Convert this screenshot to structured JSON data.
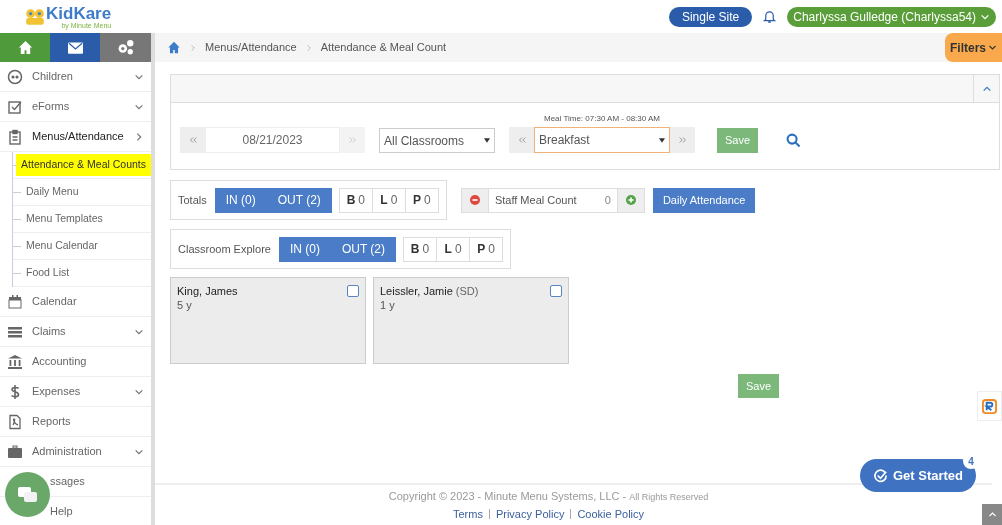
{
  "header": {
    "logo_text": "KidKare",
    "logo_tagline": "by Minute Menu",
    "site_button": "Single Site",
    "user_menu": "Charlyssa Gulledge (Charlyssa54)"
  },
  "sidebar": {
    "items": [
      {
        "label": "Children",
        "kind": "group",
        "expanded": false
      },
      {
        "label": "eForms",
        "kind": "group",
        "expanded": false
      },
      {
        "label": "Menus/Attendance",
        "kind": "group",
        "expanded": true,
        "children": [
          {
            "label": "Attendance & Meal Counts",
            "selected": true
          },
          {
            "label": "Daily Menu",
            "selected": false
          },
          {
            "label": "Menu Templates",
            "selected": false
          },
          {
            "label": "Menu Calendar",
            "selected": false
          },
          {
            "label": "Food List",
            "selected": false
          }
        ]
      },
      {
        "label": "Calendar",
        "kind": "link"
      },
      {
        "label": "Claims",
        "kind": "group",
        "expanded": false
      },
      {
        "label": "Accounting",
        "kind": "link"
      },
      {
        "label": "Expenses",
        "kind": "group",
        "expanded": false
      },
      {
        "label": "Reports",
        "kind": "link"
      },
      {
        "label": "Administration",
        "kind": "group",
        "expanded": false
      },
      {
        "label": "ssages",
        "kind": "link"
      },
      {
        "label": "Help",
        "kind": "link"
      }
    ]
  },
  "breadcrumb": [
    "Menus/Attendance",
    "Attendance & Meal Count"
  ],
  "filters_button": "Filters",
  "filters": {
    "expanded": true,
    "meal_time": "Meal Time: 07:30 AM - 08:30 AM",
    "date": "08/21/2023",
    "classroom": "All Classrooms",
    "meal": "Breakfast",
    "save": "Save"
  },
  "totals": {
    "label": "Totals",
    "in": "IN (0)",
    "out": "OUT (2)",
    "counts": [
      {
        "letter": "B",
        "value": "0"
      },
      {
        "letter": "L",
        "value": "0"
      },
      {
        "letter": "P",
        "value": "0"
      }
    ]
  },
  "staff_meal": {
    "label": "Staff Meal Count",
    "value": "0"
  },
  "daily_attendance": "Daily Attendance",
  "classroom": {
    "label": "Classroom Explore",
    "in": "IN (0)",
    "out": "OUT (2)",
    "counts": [
      {
        "letter": "B",
        "value": "0"
      },
      {
        "letter": "L",
        "value": "0"
      },
      {
        "letter": "P",
        "value": "0"
      }
    ]
  },
  "children": [
    {
      "name": "King, James",
      "age": "5 y",
      "checked": false
    },
    {
      "name": "Leissler, Jamie",
      "note": "(SD)",
      "age": "1 y",
      "checked": false
    }
  ],
  "save": "Save",
  "footer": {
    "copyright": "Copyright © 2023 - Minute Menu Systems, LLC -",
    "rights": "All Rights Reserved",
    "links": [
      "Terms",
      "Privacy Policy",
      "Cookie Policy"
    ]
  },
  "get_started": {
    "label": "Get Started",
    "badge": "4"
  }
}
